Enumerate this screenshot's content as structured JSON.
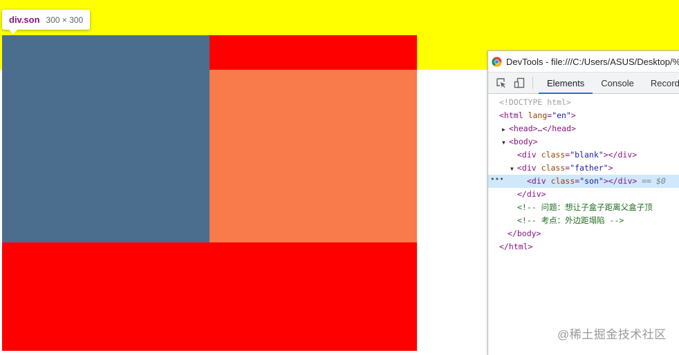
{
  "page": {
    "colors": {
      "blank_bg": "#ffff00",
      "father_bg": "#ff0000",
      "son_bg": "#4b6e8f",
      "margin_highlight": "#f97a4a"
    }
  },
  "tooltip": {
    "tag": "div.son",
    "size": "300 × 300"
  },
  "devtools": {
    "title": "DevTools - file:///C:/Users/ASUS/Desktop/%",
    "icons": [
      "chrome-icon",
      "inspect-element-icon",
      "device-toolbar-icon"
    ],
    "tabs": [
      {
        "label": "Elements",
        "active": true
      },
      {
        "label": "Console",
        "active": false
      },
      {
        "label": "Record",
        "active": false
      }
    ],
    "tree": {
      "doctype": "<!DOCTYPE html>",
      "html_open_tag": "<html",
      "html_attr": "lang",
      "html_attr_val": "\"en\"",
      "html_open_close": ">",
      "head_collapsed": "<head>…</head>",
      "body_open": "<body>",
      "blank_open": "<div",
      "blank_attr": "class",
      "blank_val": "\"blank\"",
      "blank_close": "></div>",
      "father_open": "<div",
      "father_attr": "class",
      "father_val": "\"father\"",
      "father_close": ">",
      "son_open": "<div",
      "son_attr": "class",
      "son_val": "\"son\"",
      "son_close": "></div>",
      "son_ref": "== $0",
      "div_close": "</div>",
      "comment1": "<!-- 问题：想让子盒子距离父盒子顶",
      "comment2": "<!-- 考点：外边距塌陷 -->",
      "body_close": "</body>",
      "html_close": "</html>"
    }
  },
  "watermark": "@稀土掘金技术社区"
}
